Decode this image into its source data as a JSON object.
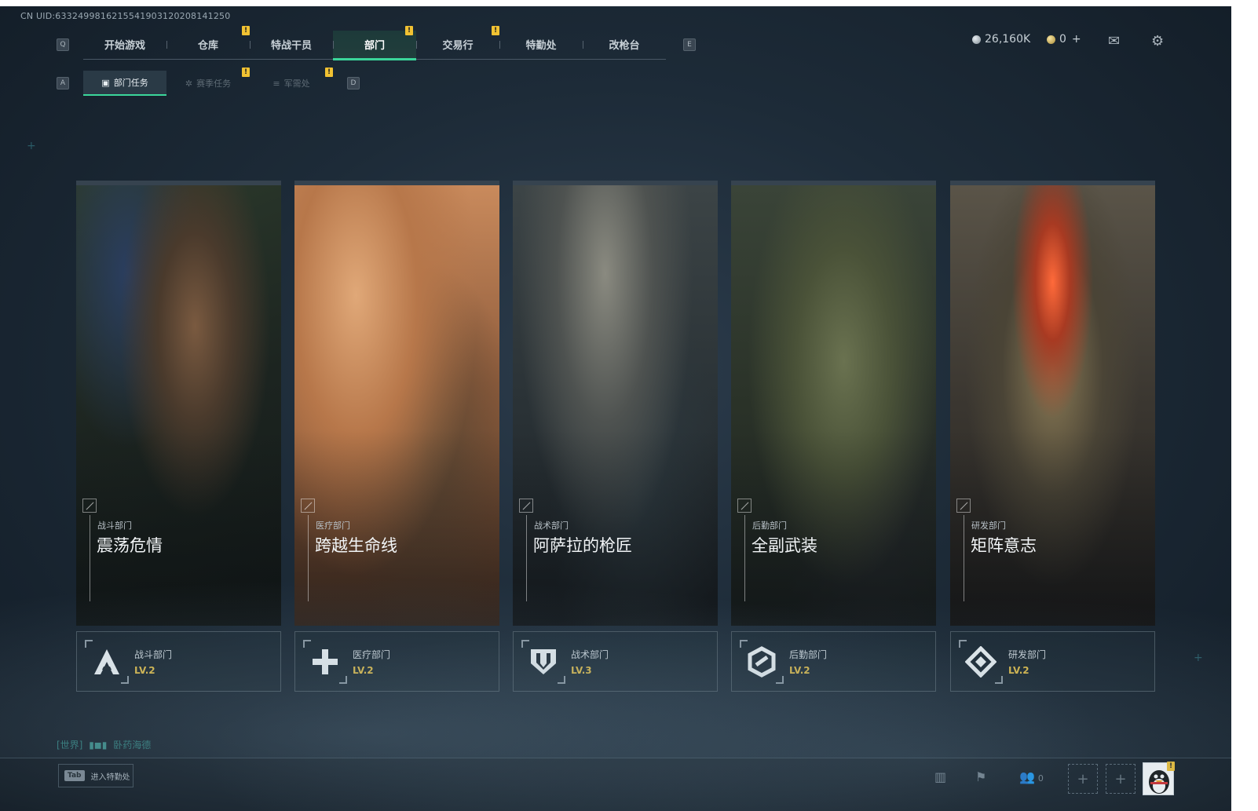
{
  "uid": "CN UID:6332499816215541903120208141250",
  "topbar": {
    "key_left": "Q",
    "key_right": "E",
    "tabs": [
      {
        "label": "开始游戏",
        "active": false,
        "alert": false
      },
      {
        "label": "仓库",
        "active": false,
        "alert": false
      },
      {
        "label": "特战干员",
        "active": false,
        "alert": true
      },
      {
        "label": "部门",
        "active": true,
        "alert": true
      },
      {
        "label": "交易行",
        "active": false,
        "alert": false
      },
      {
        "label": "特勤处",
        "active": false,
        "alert": true
      },
      {
        "label": "改枪台",
        "active": false,
        "alert": false
      }
    ],
    "alert_mark": "!"
  },
  "subbar": {
    "key_left": "A",
    "key_right": "D",
    "tabs": [
      {
        "label": "部门任务",
        "active": true
      },
      {
        "label": "赛季任务",
        "active": false
      },
      {
        "label": "军需处",
        "active": false
      }
    ]
  },
  "resources": {
    "silver": "26,160K",
    "gold": "0",
    "gold_add": "+"
  },
  "cards": [
    {
      "dept": "战斗部门",
      "title": "震荡危情",
      "level": "LV.2",
      "icon": "combat-emblem-icon"
    },
    {
      "dept": "医疗部门",
      "title": "跨越生命线",
      "level": "LV.2",
      "icon": "medical-cross-icon"
    },
    {
      "dept": "战术部门",
      "title": "阿萨拉的枪匠",
      "level": "LV.3",
      "icon": "tactical-shield-icon"
    },
    {
      "dept": "后勤部门",
      "title": "全副武装",
      "level": "LV.2",
      "icon": "logistics-hex-icon"
    },
    {
      "dept": "研发部门",
      "title": "矩阵意志",
      "level": "LV.2",
      "icon": "research-diamond-icon"
    }
  ],
  "chat": {
    "channel": "[世界]",
    "name": "卧药海德"
  },
  "bottom": {
    "tab_key": "Tab",
    "tab_label": "进入特勤处",
    "friends_count": "0",
    "slot_symbol": "+"
  },
  "colors": {
    "accent": "#3bd69a",
    "alert": "#f1c232",
    "level": "#d9b84a"
  }
}
